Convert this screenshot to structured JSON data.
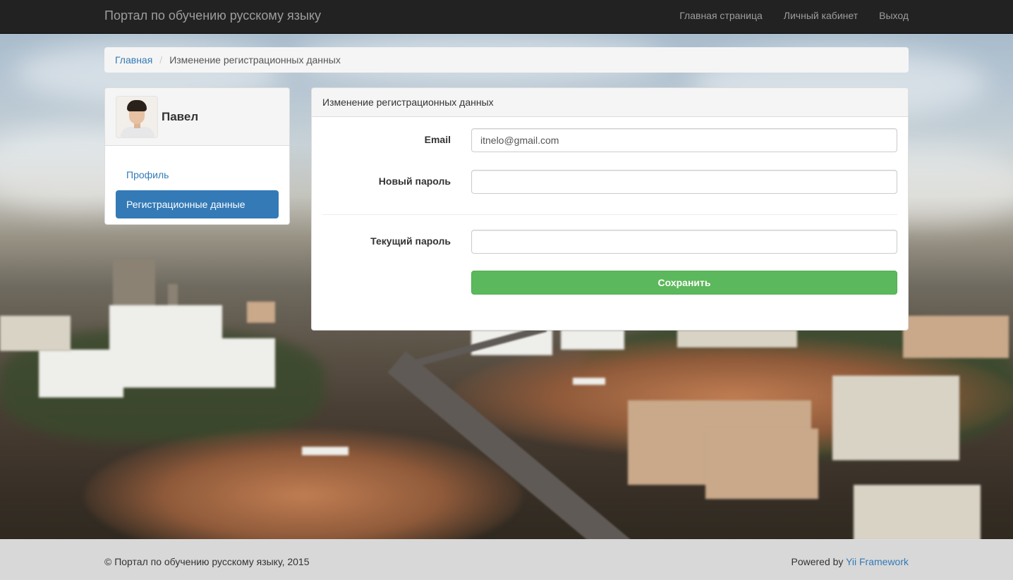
{
  "navbar": {
    "brand": "Портал по обучению русскому языку",
    "links": [
      "Главная страница",
      "Личный кабинет",
      "Выход"
    ]
  },
  "breadcrumb": {
    "home": "Главная",
    "separator": "/",
    "current": "Изменение регистрационных данных"
  },
  "sidebar": {
    "user_name": "Павел",
    "items": [
      {
        "label": "Профиль",
        "active": false
      },
      {
        "label": "Регистрационные данные",
        "active": true
      }
    ]
  },
  "form": {
    "title": "Изменение регистрационных данных",
    "email_label": "Email",
    "email_value": "itnelo@gmail.com",
    "new_password_label": "Новый пароль",
    "new_password_value": "",
    "current_password_label": "Текущий пароль",
    "current_password_value": "",
    "save_label": "Сохранить"
  },
  "footer": {
    "copyright": "© Портал по обучению русскому языку, 2015",
    "powered_prefix": "Powered by",
    "powered_link": "Yii Framework"
  },
  "colors": {
    "navbar_bg": "#222222",
    "link": "#337ab7",
    "primary": "#337ab7",
    "success": "#5cb85c"
  }
}
